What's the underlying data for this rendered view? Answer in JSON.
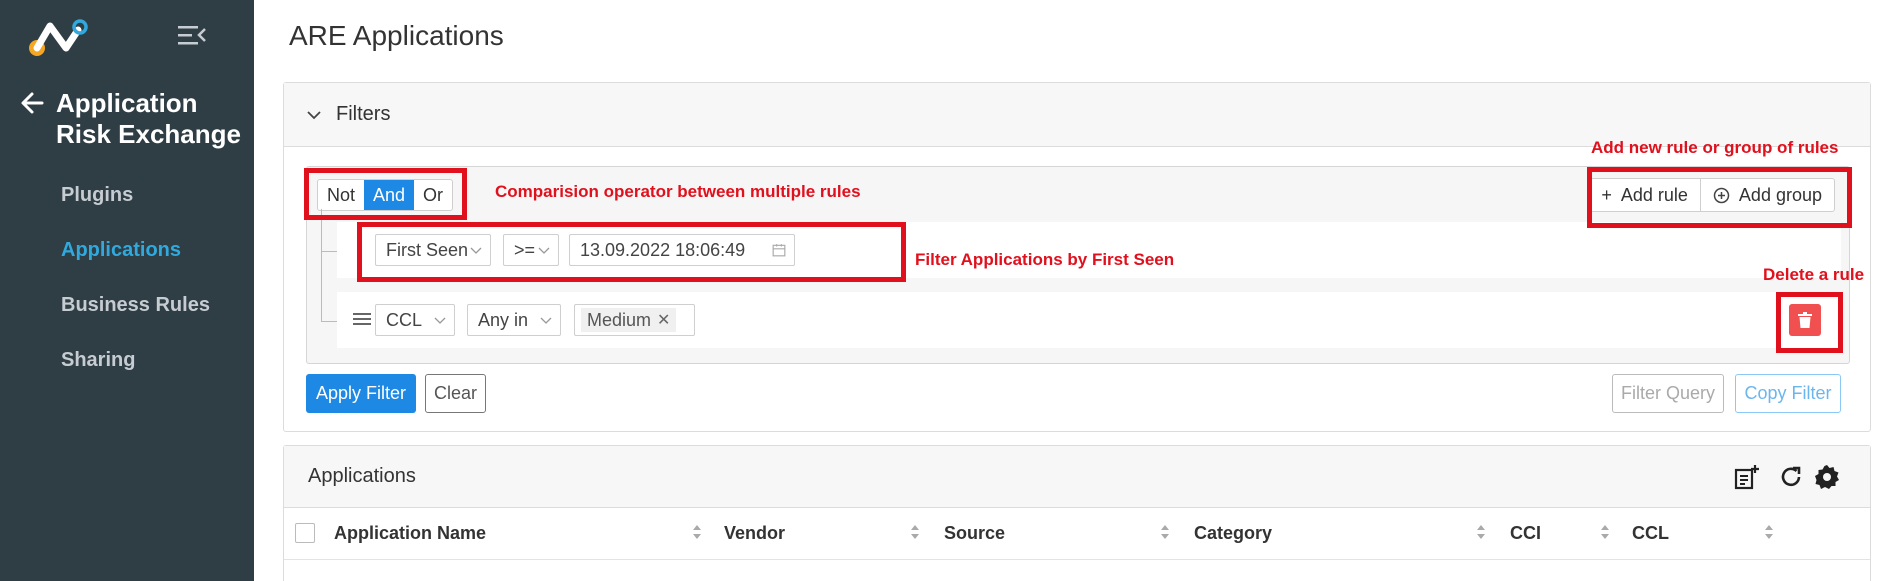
{
  "app": {
    "module_title": "Application Risk Exchange",
    "page_title": "ARE Applications"
  },
  "sidebar": {
    "items": [
      {
        "label": "Plugins",
        "active": false
      },
      {
        "label": "Applications",
        "active": true
      },
      {
        "label": "Business Rules",
        "active": false
      },
      {
        "label": "Sharing",
        "active": false
      }
    ]
  },
  "filters": {
    "title": "Filters",
    "operators": [
      "Not",
      "And",
      "Or"
    ],
    "active_operator": "And",
    "add_rule_label": "Add rule",
    "add_group_label": "Add group",
    "rules": [
      {
        "field": "First Seen",
        "operator": ">=",
        "value": "13.09.2022 18:06:49"
      },
      {
        "field": "CCL",
        "operator": "Any in",
        "tags": [
          "Medium"
        ]
      }
    ],
    "apply_label": "Apply Filter",
    "clear_label": "Clear",
    "filter_query_label": "Filter Query",
    "copy_filter_label": "Copy Filter"
  },
  "annotations": {
    "operator": "Comparision operator between multiple rules",
    "add": "Add new rule or group of rules",
    "first_seen": "Filter Applications by First Seen",
    "delete": "Delete a rule",
    "color": "#e0101d"
  },
  "applications": {
    "title": "Applications",
    "columns": [
      "Application Name",
      "Vendor",
      "Source",
      "Category",
      "CCI",
      "CCL"
    ],
    "header_icons": [
      "add-list-icon",
      "refresh-icon",
      "settings-gear-icon"
    ]
  },
  "colors": {
    "sidebar_bg": "#2f3d45",
    "accent": "#31a9dd",
    "primary": "#1e88e5",
    "danger": "#f05050"
  }
}
